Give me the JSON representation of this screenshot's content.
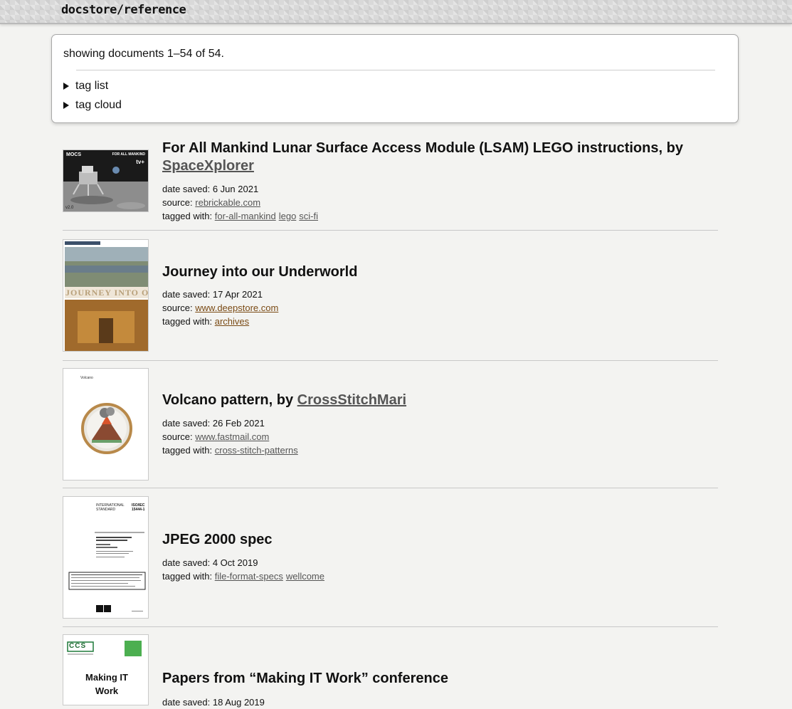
{
  "header": {
    "title": "docstore/reference"
  },
  "summary": {
    "text": "showing documents 1–54 of 54.",
    "tag_list": "tag list",
    "tag_cloud": "tag cloud"
  },
  "labels": {
    "date_saved": "date saved:",
    "source": "source:",
    "tagged_with": "tagged with:"
  },
  "documents": [
    {
      "title": "For All Mankind Lunar Surface Access Module (LSAM) LEGO instructions, by",
      "author": "SpaceXplorer",
      "date": "6 Jun 2021",
      "source": "rebrickable.com",
      "tags": [
        "for-all-mankind",
        "lego",
        "sci-fi"
      ],
      "thumb_text": {
        "brand": "MOCS",
        "show": "FOR ALL MANKIND",
        "network": "tv+",
        "version": "v2.0"
      }
    },
    {
      "title": "Journey into our Underworld",
      "date": "17 Apr 2021",
      "source": "www.deepstore.com",
      "tags": [
        "archives"
      ],
      "thumb_text": {
        "banner": "JOURNEY INTO O"
      }
    },
    {
      "title": "Volcano pattern, by",
      "author": "CrossStitchMari",
      "date": "26 Feb 2021",
      "source": "www.fastmail.com",
      "tags": [
        "cross-stitch-patterns"
      ],
      "thumb_text": {
        "heading": "Volcano"
      }
    },
    {
      "title": "JPEG 2000 spec",
      "date": "4 Oct 2019",
      "tags": [
        "file-format-specs",
        "wellcome"
      ],
      "thumb_text": {
        "std_left": "INTERNATIONAL STANDARD",
        "std_right": "ISO/IEC 15444-1"
      }
    },
    {
      "title": "Papers from “Making IT Work” conference",
      "date": "18 Aug 2019",
      "thumb_text": {
        "logo": "CCS",
        "title": "Making IT Work"
      }
    }
  ],
  "colors": {
    "link": "#555555",
    "brown_link": "#7a4a14",
    "background": "#f3f3f1"
  }
}
